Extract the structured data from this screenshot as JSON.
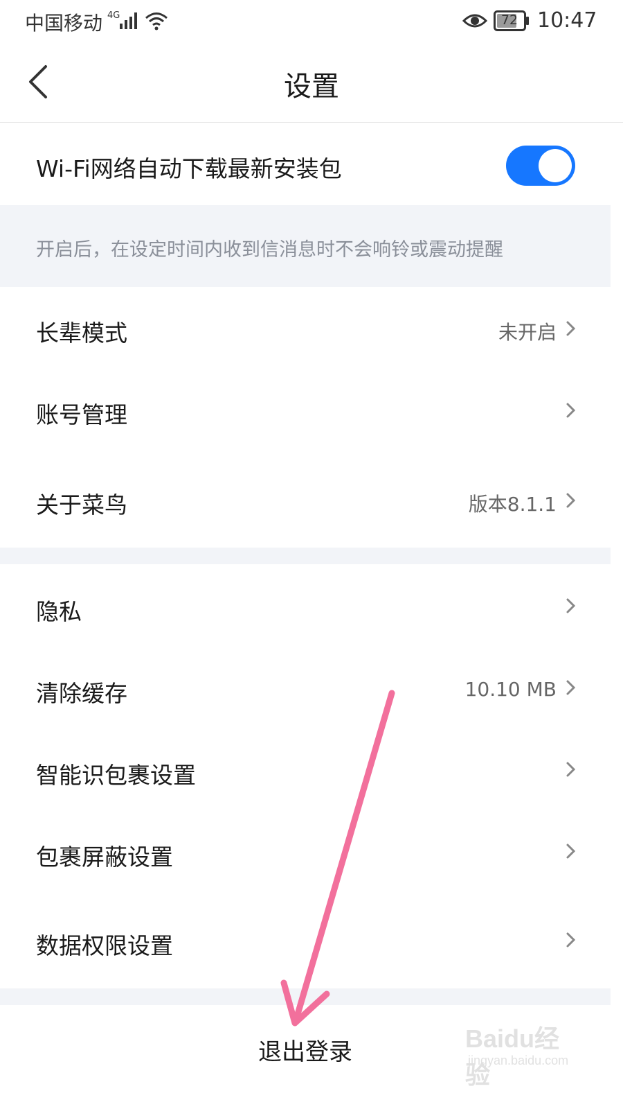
{
  "status_bar": {
    "carrier": "中国移动",
    "network": "4G",
    "battery": "72",
    "time": "10:47",
    "icons": [
      "signal-icon",
      "wifi-icon",
      "eye-icon",
      "battery-icon"
    ]
  },
  "header": {
    "title": "设置",
    "back_icon": "chevron-left-icon"
  },
  "settings": {
    "wifi_download": {
      "label": "Wi-Fi网络自动下载最新安装包",
      "enabled": true
    },
    "hint": "开启后，在设定时间内收到信消息时不会响铃或震动提醒",
    "elder_mode": {
      "label": "长辈模式",
      "value": "未开启"
    },
    "account": {
      "label": "账号管理"
    },
    "about": {
      "label": "关于菜鸟",
      "value": "版本8.1.1"
    },
    "privacy": {
      "label": "隐私"
    },
    "cache": {
      "label": "清除缓存",
      "value": "10.10 MB"
    },
    "smart_parcel": {
      "label": "智能识包裹设置"
    },
    "parcel_block": {
      "label": "包裹屏蔽设置"
    },
    "data_permission": {
      "label": "数据权限设置"
    }
  },
  "logout": {
    "label": "退出登录"
  },
  "colors": {
    "accent": "#1677ff",
    "band": "#f2f4f8",
    "annotation": "#f2709c"
  },
  "watermark": {
    "brand": "Baidu经验",
    "url": "jingyan.baidu.com"
  }
}
